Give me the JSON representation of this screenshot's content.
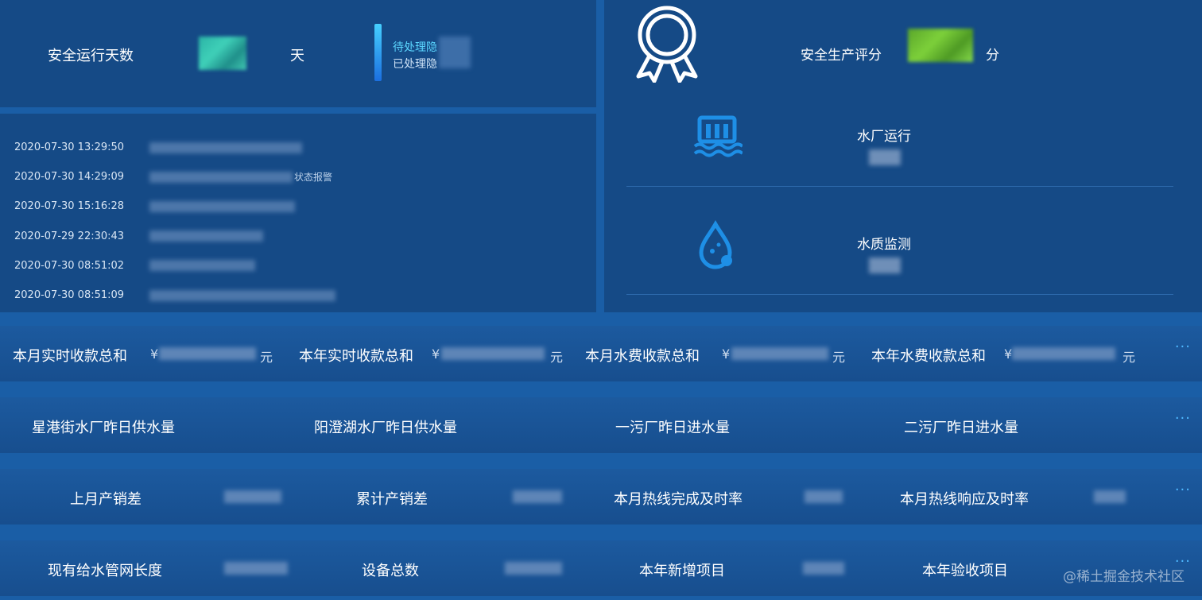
{
  "safety": {
    "days_label": "安全运行天数",
    "days_unit": "天",
    "hazard_pending": "待处理隐",
    "hazard_done": "已处理隐"
  },
  "logs": [
    {
      "time": "2020-07-30 13:29:50",
      "tail": ""
    },
    {
      "time": "2020-07-30 14:29:09",
      "tail": "状态报警"
    },
    {
      "time": "2020-07-30 15:16:28",
      "tail": ""
    },
    {
      "time": "2020-07-29 22:30:43",
      "tail": ""
    },
    {
      "time": "2020-07-30 08:51:02",
      "tail": ""
    },
    {
      "time": "2020-07-30 08:51:09",
      "tail": ""
    }
  ],
  "score": {
    "label": "安全生产评分",
    "unit": "分"
  },
  "plant": {
    "title": "水厂运行"
  },
  "quality": {
    "title": "水质监测"
  },
  "row1": {
    "items": [
      {
        "label": "本月实时收款总和",
        "yen": "¥",
        "unit": "元"
      },
      {
        "label": "本年实时收款总和",
        "yen": "¥",
        "unit": "元"
      },
      {
        "label": "本月水费收款总和",
        "yen": "¥",
        "unit": "元"
      },
      {
        "label": "本年水费收款总和",
        "yen": "¥",
        "unit": "元"
      }
    ]
  },
  "row2": {
    "items": [
      {
        "label": "星港街水厂昨日供水量"
      },
      {
        "label": "阳澄湖水厂昨日供水量"
      },
      {
        "label": "一污厂昨日进水量"
      },
      {
        "label": "二污厂昨日进水量"
      }
    ]
  },
  "row3": {
    "items": [
      {
        "label": "上月产销差"
      },
      {
        "label": "累计产销差"
      },
      {
        "label": "本月热线完成及时率"
      },
      {
        "label": "本月热线响应及时率"
      }
    ]
  },
  "row4": {
    "items": [
      {
        "label": "现有给水管网长度"
      },
      {
        "label": "设备总数"
      },
      {
        "label": "本年新增项目"
      },
      {
        "label": "本年验收项目"
      }
    ]
  },
  "more_label": "···",
  "watermark": "@稀土掘金技术社区",
  "colors": {
    "background": "#1a5ea6",
    "panel": "#154a86",
    "accent": "#4fb8ff",
    "icon_blue": "#1e8fe6"
  }
}
